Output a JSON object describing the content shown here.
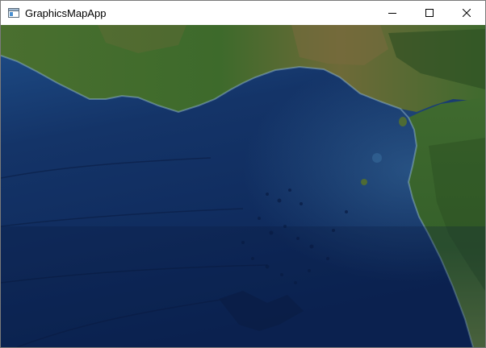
{
  "window": {
    "title": "GraphicsMapApp",
    "app_icon": "window-app-icon",
    "controls": {
      "minimize_icon": "minimize-icon",
      "maximize_icon": "maximize-icon",
      "close_icon": "close-icon"
    }
  },
  "map": {
    "basemap_style": "satellite-imagery",
    "colors": {
      "ocean_deep": "#0c2556",
      "ocean_mid": "#173a72",
      "ocean_shelf": "#2f5f93",
      "land_green": "#3f6a2e",
      "land_dark": "#2b4d22",
      "land_brown": "#7a6a3e",
      "coast_light": "#8fb3c9"
    }
  }
}
